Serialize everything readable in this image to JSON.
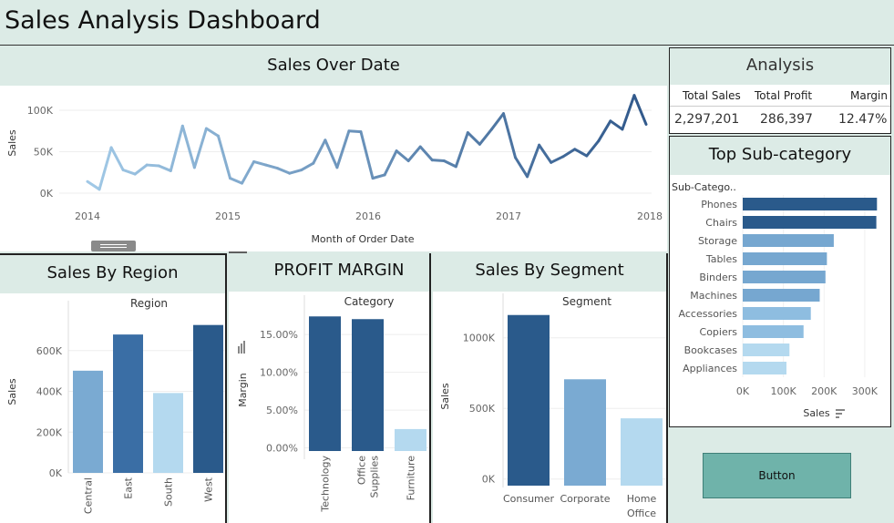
{
  "dashboard": {
    "title": "Sales Analysis Dashboard"
  },
  "analysis": {
    "title": "Analysis",
    "labels": [
      "Total Sales",
      "Total Profit",
      "Margin"
    ],
    "values": [
      "2,297,201",
      "286,397",
      "12.47%"
    ]
  },
  "button": {
    "label": "Button"
  },
  "colors": {
    "panel_header": "#dcebe6",
    "dark_blue": "#2a5a8b",
    "mid_blue": "#3a6ea5",
    "light_blue": "#76a7d0",
    "pale_blue": "#b4d9ef"
  },
  "icons": [
    "close-icon",
    "popout-icon",
    "filter-icon",
    "dropdown-icon",
    "sort-icon",
    "drag-handle-icon"
  ],
  "chart_data": [
    {
      "id": "sales_over_date",
      "type": "line",
      "title": "Sales Over Date",
      "xlabel": "Month of Order Date",
      "ylabel": "Sales",
      "x_ticks": [
        "2014",
        "2015",
        "2016",
        "2017",
        "2018"
      ],
      "y_ticks": [
        "0K",
        "50K",
        "100K"
      ],
      "ylim": [
        0,
        125000
      ],
      "start": "2014-01",
      "values": [
        14000,
        4600,
        55000,
        28000,
        23000,
        34000,
        33000,
        27000,
        81000,
        31000,
        78000,
        69000,
        18000,
        12000,
        38000,
        34000,
        30000,
        24000,
        28000,
        36000,
        64000,
        31000,
        75000,
        74000,
        18000,
        22000,
        51000,
        39000,
        56000,
        40000,
        39000,
        32000,
        73000,
        59000,
        77000,
        96000,
        43000,
        20000,
        58000,
        37000,
        44000,
        53000,
        45000,
        63000,
        87000,
        77000,
        118000,
        83000
      ]
    },
    {
      "id": "sales_by_region",
      "type": "bar",
      "title": "Sales By Region",
      "header": "Region",
      "ylabel": "Sales",
      "categories": [
        "Central",
        "East",
        "South",
        "West"
      ],
      "values": [
        501240,
        678781,
        391722,
        725458
      ],
      "ylim": [
        0,
        800000
      ],
      "y_ticks": [
        "0K",
        "200K",
        "400K",
        "600K"
      ],
      "colors": [
        "#7aaad2",
        "#3a6ea5",
        "#b4d9ef",
        "#2a5a8b"
      ]
    },
    {
      "id": "profit_margin",
      "type": "bar",
      "title": "PROFIT MARGIN",
      "header": "Category",
      "ylabel": "Margin",
      "categories": [
        "Technology",
        "Office Supplies",
        "Furniture"
      ],
      "values": [
        17.4,
        17.04,
        2.49
      ],
      "ylim": [
        -1.5,
        19
      ],
      "y_ticks": [
        "0.00%",
        "5.00%",
        "10.00%",
        "15.00%"
      ],
      "colors": [
        "#2a5a8b",
        "#2a5a8b",
        "#b4d9ef"
      ]
    },
    {
      "id": "sales_by_segment",
      "type": "bar",
      "title": "Sales By Segment",
      "header": "Segment",
      "ylabel": "Sales",
      "categories": [
        "Consumer",
        "Corporate",
        "Home Office"
      ],
      "values": [
        1161401,
        706146,
        429653
      ],
      "ylim": [
        -60000,
        1250000
      ],
      "y_ticks": [
        "0K",
        "500K",
        "1000K"
      ],
      "colors": [
        "#2a5a8b",
        "#7aaad2",
        "#b4d9ef"
      ]
    },
    {
      "id": "top_sub_category",
      "type": "bar",
      "orientation": "horizontal",
      "title": "Top Sub-category",
      "header": "Sub-Catego..",
      "xlabel": "Sales",
      "categories": [
        "Phones",
        "Chairs",
        "Storage",
        "Tables",
        "Binders",
        "Machines",
        "Accessories",
        "Copiers",
        "Bookcases",
        "Appliances"
      ],
      "values": [
        330007,
        328449,
        223844,
        206966,
        203413,
        189239,
        167380,
        149528,
        114880,
        107532
      ],
      "xlim": [
        0,
        345000
      ],
      "x_ticks": [
        "0K",
        "100K",
        "200K",
        "300K"
      ],
      "colors": [
        "#2a5a8b",
        "#2a5a8b",
        "#76a7d0",
        "#76a7d0",
        "#76a7d0",
        "#76a7d0",
        "#8ebde0",
        "#8ebde0",
        "#b4d9ef",
        "#b4d9ef"
      ]
    }
  ]
}
